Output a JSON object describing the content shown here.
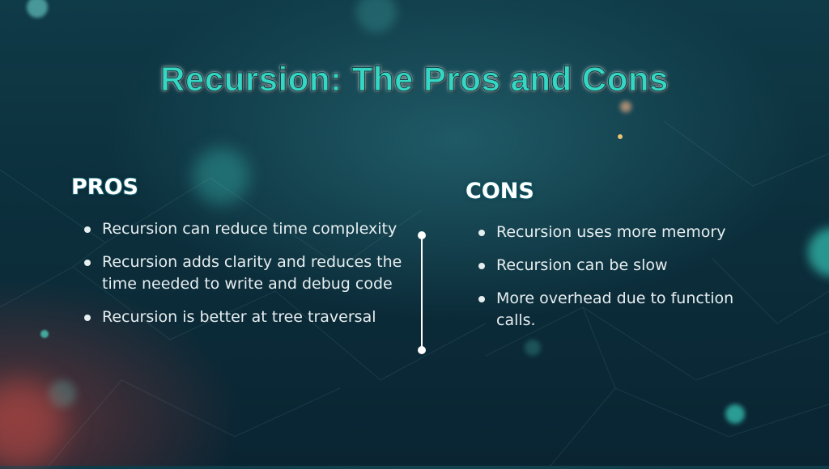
{
  "slide": {
    "title": "Recursion: The Pros and Cons",
    "pros": {
      "heading": "PROS",
      "items": [
        "Recursion can reduce time complexity",
        "Recursion adds clarity and reduces the time needed to write and debug code",
        "Recursion is better at tree traversal"
      ]
    },
    "cons": {
      "heading": "CONS",
      "items": [
        "Recursion uses more memory",
        "Recursion can be slow",
        "More overhead due to function calls."
      ]
    }
  },
  "colors": {
    "title": "#35d6c4",
    "background": "#0f3a47",
    "text": "#e6eef0",
    "accent_glow": "#2bd6c2"
  }
}
